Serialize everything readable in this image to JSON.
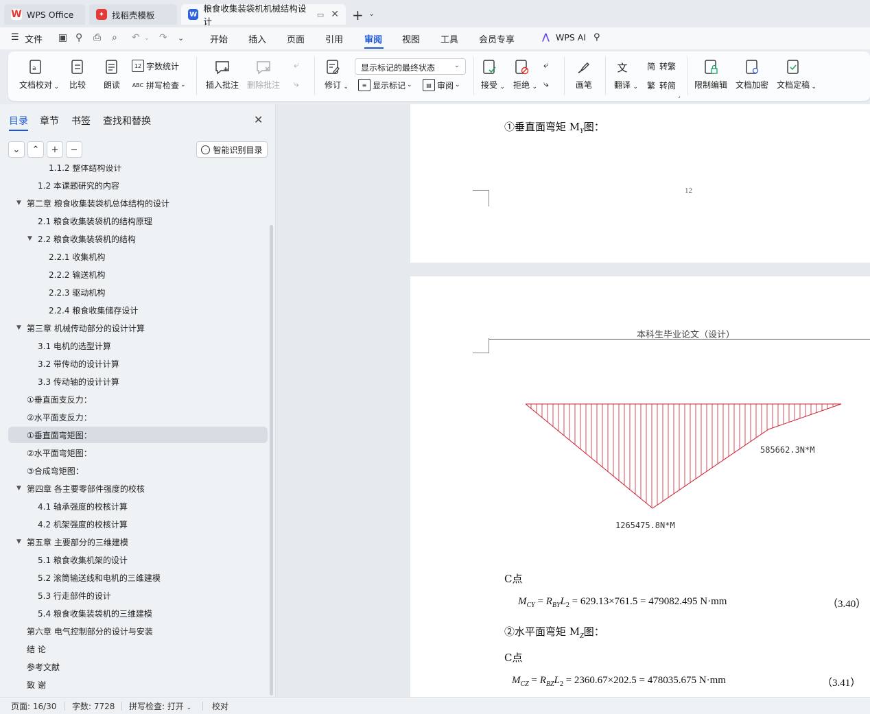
{
  "titlebar": {
    "tabs": [
      {
        "label": "WPS Office",
        "icon": "wps-logo-icon",
        "color": "#e53935"
      },
      {
        "label": "找稻壳模板",
        "icon": "docer-icon",
        "color": "#e53935"
      },
      {
        "label": "粮食收集装袋机机械结构设计",
        "icon": "writer-icon",
        "color": "#2b62e0"
      }
    ],
    "new_tab": "+"
  },
  "menubar": {
    "file": "文件",
    "items": [
      "开始",
      "插入",
      "页面",
      "引用",
      "审阅",
      "视图",
      "工具",
      "会员专享"
    ],
    "active": "审阅",
    "ai": "WPS AI"
  },
  "ribbon": {
    "doc_check": "文档校对",
    "compare": "比较",
    "read_aloud": "朗读",
    "word_count": "字数统计",
    "spell_check": "拼写检查",
    "insert_comment": "插入批注",
    "delete_comment": "删除批注",
    "track": "修订",
    "display_mode": "显示标记的最终状态",
    "show_markup": "显示标记",
    "review": "审阅",
    "accept": "接受",
    "reject": "拒绝",
    "pen": "画笔",
    "translate": "翻译",
    "to_traditional": "转繁",
    "to_simplified": "转简",
    "restrict_edit": "限制编辑",
    "encrypt": "文档加密",
    "finalize": "文档定稿"
  },
  "sidebar": {
    "tabs": [
      "目录",
      "章节",
      "书签",
      "查找和替换"
    ],
    "smart_toc": "智能识别目录",
    "toc": [
      {
        "text": "1.1.2 整体结构设计",
        "level": 3,
        "arrow": ""
      },
      {
        "text": "1.2  本课题研究的内容",
        "level": 2,
        "arrow": ""
      },
      {
        "text": "第二章  粮食收集装袋机总体结构的设计",
        "level": 1,
        "arrow": "▼"
      },
      {
        "text": "2.1  粮食收集装袋机的结构原理",
        "level": 2,
        "arrow": ""
      },
      {
        "text": "2.2  粮食收集装袋机的结构",
        "level": 2,
        "arrow": "▼"
      },
      {
        "text": "2.2.1    收集机构",
        "level": 3,
        "arrow": ""
      },
      {
        "text": "2.2.2    输送机构",
        "level": 3,
        "arrow": ""
      },
      {
        "text": "2.2.3  驱动机构",
        "level": 3,
        "arrow": ""
      },
      {
        "text": "2.2.4  粮食收集储存设计",
        "level": 3,
        "arrow": ""
      },
      {
        "text": "第三章  机械传动部分的设计计算",
        "level": 1,
        "arrow": "▼"
      },
      {
        "text": "3.1  电机的选型计算",
        "level": 2,
        "arrow": ""
      },
      {
        "text": "3.2  带传动的设计计算",
        "level": 2,
        "arrow": ""
      },
      {
        "text": "3.3  传动轴的设计计算",
        "level": 2,
        "arrow": ""
      },
      {
        "text": "①垂直面支反力：",
        "level": 1,
        "arrow": ""
      },
      {
        "text": "②水平面支反力：",
        "level": 1,
        "arrow": ""
      },
      {
        "text": "①垂直面弯矩图：",
        "level": 1,
        "arrow": "",
        "selected": true
      },
      {
        "text": "②水平面弯矩图：",
        "level": 1,
        "arrow": ""
      },
      {
        "text": "③合成弯矩图：",
        "level": 1,
        "arrow": ""
      },
      {
        "text": "第四章  各主要零部件强度的校核",
        "level": 1,
        "arrow": "▼"
      },
      {
        "text": "4.1  轴承强度的校核计算",
        "level": 2,
        "arrow": ""
      },
      {
        "text": "4.2  机架强度的校核计算",
        "level": 2,
        "arrow": ""
      },
      {
        "text": "第五章  主要部分的三维建模",
        "level": 1,
        "arrow": "▼"
      },
      {
        "text": "5.1  粮食收集机架的设计",
        "level": 2,
        "arrow": ""
      },
      {
        "text": "5.2  滚筒输送线和电机的三维建模",
        "level": 2,
        "arrow": ""
      },
      {
        "text": "5.3  行走部件的设计",
        "level": 2,
        "arrow": ""
      },
      {
        "text": "5.4  粮食收集装袋机的三维建模",
        "level": 2,
        "arrow": ""
      },
      {
        "text": "第六章  电气控制部分的设计与安装",
        "level": 1,
        "arrow": ""
      },
      {
        "text": "结    论",
        "level": 1,
        "arrow": ""
      },
      {
        "text": "参考文献",
        "level": 1,
        "arrow": ""
      },
      {
        "text": "致    谢",
        "level": 1,
        "arrow": ""
      }
    ]
  },
  "document": {
    "page1_heading": "①垂直面弯矩 M",
    "page1_heading_sub": "Y",
    "page1_heading_tail": "图：",
    "page_number": "12",
    "header_title": "本科生毕业论文（设计）",
    "diagram_label_right": "585662.3N*M",
    "diagram_label_bottom": "1265475.8N*M",
    "point_c_1": "C点",
    "eq1_lhs": "M",
    "eq1_lhs_sub": "CY",
    "eq1_mid": "R",
    "eq1_mid_sub": "BY",
    "eq1_L": "L",
    "eq1_L_sub": "2",
    "eq1_rhs": "= 629.13×761.5 = 479082.495 N·mm",
    "eq1_num": "（3.40）",
    "heading2": "②水平面弯矩 M",
    "heading2_sub": "Z",
    "heading2_tail": "图：",
    "point_c_2": "C点",
    "eq2_lhs": "M",
    "eq2_lhs_sub": "CZ",
    "eq2_mid": "R",
    "eq2_mid_sub": "BZ",
    "eq2_L": "L",
    "eq2_L_sub": "2",
    "eq2_rhs": "= 2360.67×202.5 = 478035.675 N·mm",
    "eq2_num": "（3.41）"
  },
  "statusbar": {
    "page": "页面: 16/30",
    "words": "字数: 7728",
    "spell": "拼写检查: 打开",
    "proof": "校对"
  },
  "colors": {
    "accent": "#1a56db",
    "diagram_hatch": "#cc1f2f"
  }
}
